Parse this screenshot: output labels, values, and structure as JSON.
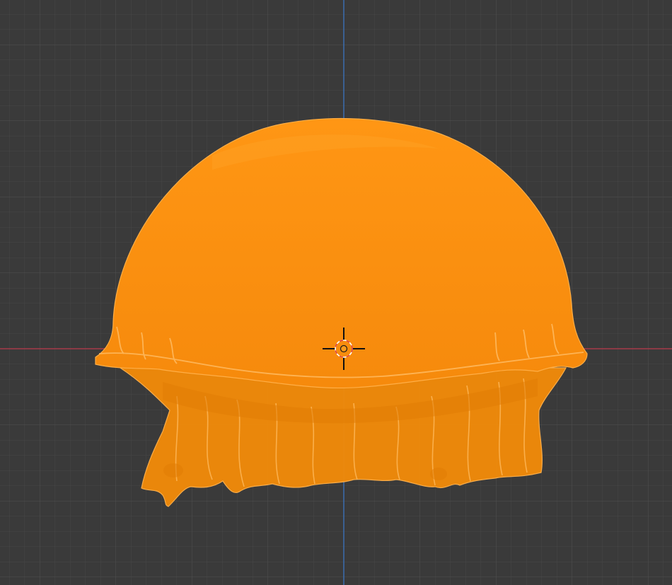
{
  "viewport": {
    "background_color": "#3a3a3a",
    "grid_minor_color": "#444444",
    "grid_major_color": "#4d4d4d",
    "x_axis_color": "#a83a4a",
    "z_axis_color": "#3a6db0",
    "selection_color": "#ff9a1a",
    "selection_shade_color": "#e88708",
    "cursor_ring_color": "#ffffff",
    "cursor_ring_dash_color": "#e0403a",
    "origin_color": "#ff9a1a"
  },
  "scene": {
    "selected_object_icon": "jellyfish-mesh-icon",
    "cursor_icon": "3d-cursor-icon",
    "origin_icon": "object-origin-icon"
  }
}
